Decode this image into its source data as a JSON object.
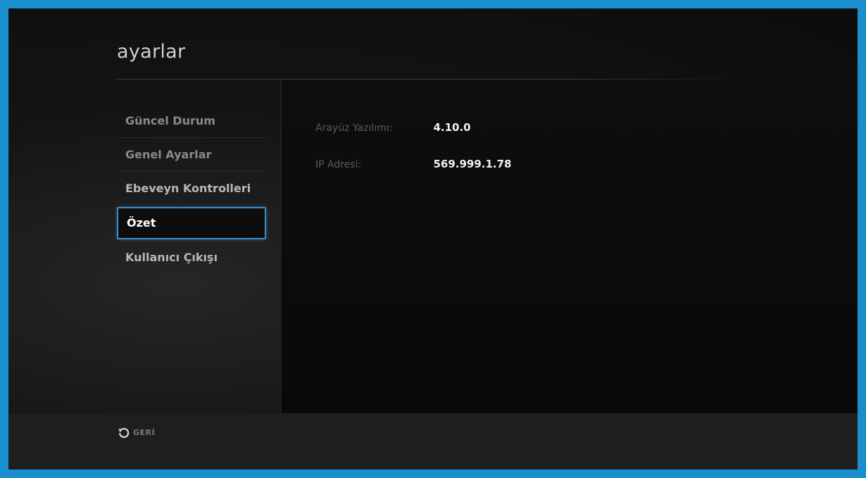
{
  "title": "ayarlar",
  "sidebar": {
    "items": [
      {
        "label": "Güncel Durum"
      },
      {
        "label": "Genel Ayarlar"
      },
      {
        "label": "Ebeveyn Kontrolleri"
      },
      {
        "label": "Özet",
        "selected": true
      },
      {
        "label": "Kullanıcı Çıkışı"
      }
    ]
  },
  "info": {
    "rows": [
      {
        "label": "Arayüz Yazılımı:",
        "value": "4.10.0"
      },
      {
        "label": "IP Adresi:",
        "value": "569.999.1.78"
      }
    ]
  },
  "footer": {
    "back_label": "GERİ",
    "back_icon": "back-arrow-icon"
  },
  "colors": {
    "outer_border": "#1a8fd0",
    "selection_border": "#3a8fcf",
    "background": "#141414"
  }
}
